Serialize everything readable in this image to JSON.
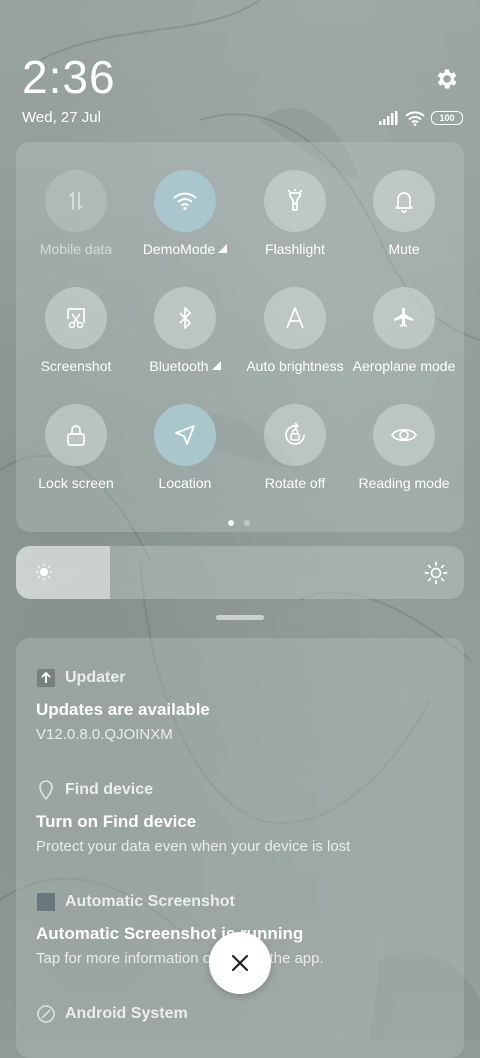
{
  "status": {
    "time": "2:36",
    "date": "Wed, 27 Jul",
    "battery": "100"
  },
  "quick_tiles": [
    {
      "label": "Mobile data",
      "icon": "mobile-data-icon",
      "state": "disabled"
    },
    {
      "label": "DemoMode",
      "icon": "wifi-icon",
      "state": "active"
    },
    {
      "label": "Flashlight",
      "icon": "flashlight-icon",
      "state": "off"
    },
    {
      "label": "Mute",
      "icon": "bell-icon",
      "state": "off"
    },
    {
      "label": "Screenshot",
      "icon": "scissors-icon",
      "state": "off"
    },
    {
      "label": "Bluetooth",
      "icon": "bluetooth-icon",
      "state": "off"
    },
    {
      "label": "Auto brightness",
      "icon": "auto-brightness-icon",
      "state": "off"
    },
    {
      "label": "Aeroplane mode",
      "icon": "airplane-icon",
      "state": "off"
    },
    {
      "label": "Lock screen",
      "icon": "lock-icon",
      "state": "off"
    },
    {
      "label": "Location",
      "icon": "location-icon",
      "state": "active"
    },
    {
      "label": "Rotate off",
      "icon": "rotate-lock-icon",
      "state": "off"
    },
    {
      "label": "Reading mode",
      "icon": "eye-icon",
      "state": "off"
    }
  ],
  "pager": {
    "pages": 2,
    "current": 1
  },
  "brightness": {
    "level": 0.21
  },
  "notifications": [
    {
      "app": "Updater",
      "title": "Updates are available",
      "text": "V12.0.8.0.QJOINXM"
    },
    {
      "app": "Find device",
      "title": "Turn on Find device",
      "text": "Protect your data even when your device is lost"
    },
    {
      "app": "Automatic Screenshot",
      "title": "Automatic Screenshot is running",
      "text": "Tap for more information or to stop the app."
    },
    {
      "app": "Android System",
      "title": "",
      "text": ""
    }
  ],
  "colors": {
    "active_tile": "#a9c6cc",
    "accent_white": "#ffffff"
  }
}
